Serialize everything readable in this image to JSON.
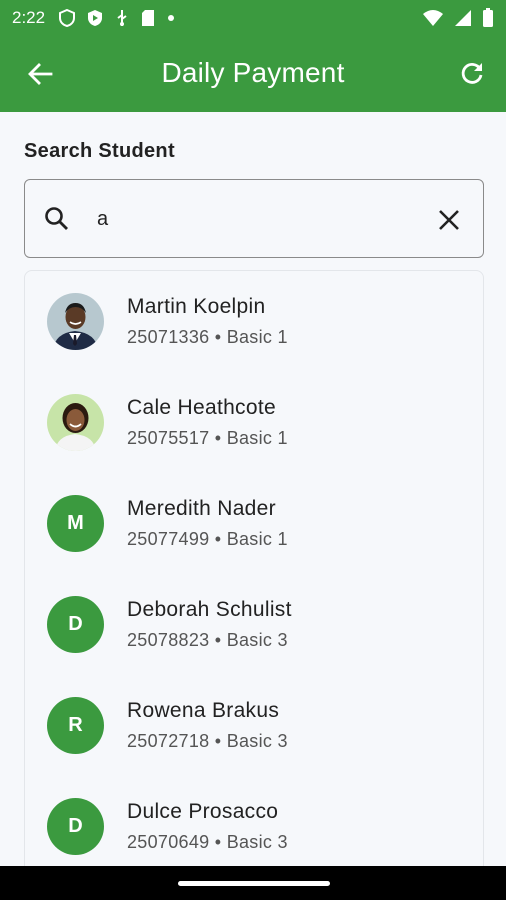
{
  "status": {
    "time": "2:22"
  },
  "app_bar": {
    "title": "Daily Payment"
  },
  "search": {
    "label": "Search Student",
    "value": "a"
  },
  "students": [
    {
      "name": "Martin Koelpin",
      "meta": "25071336 • Basic 1",
      "avatar": "photo-man"
    },
    {
      "name": "Cale Heathcote",
      "meta": "25075517 • Basic 1",
      "avatar": "photo-woman"
    },
    {
      "name": "Meredith Nader",
      "meta": "25077499 • Basic 1",
      "initial": "M"
    },
    {
      "name": "Deborah Schulist",
      "meta": "25078823 • Basic 3",
      "initial": "D"
    },
    {
      "name": "Rowena Brakus",
      "meta": "25072718 • Basic 3",
      "initial": "R"
    },
    {
      "name": "Dulce Prosacco",
      "meta": "25070649 • Basic 3",
      "initial": "D"
    }
  ],
  "colors": {
    "primary": "#3b9a3f",
    "background": "#f6f8fb"
  }
}
